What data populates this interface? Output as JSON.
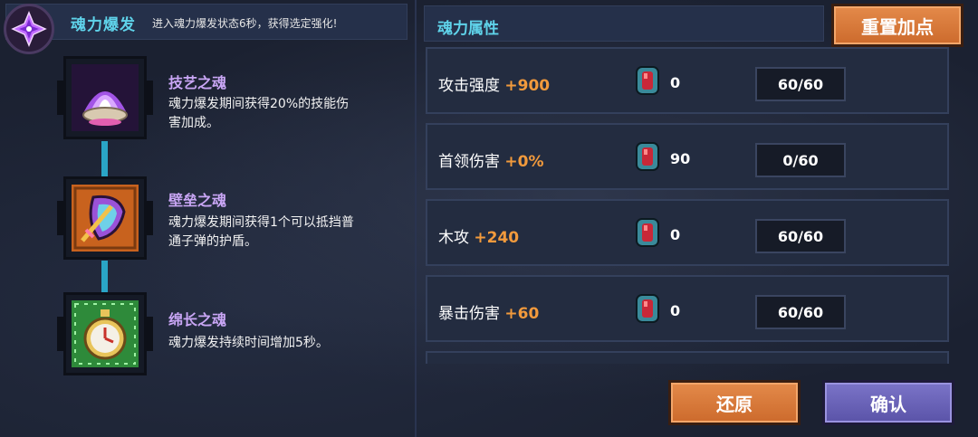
{
  "burst": {
    "title": "魂力爆发",
    "description": "进入魂力爆发状态6秒，获得选定强化!",
    "icon": "purple-crystal-burst-icon"
  },
  "skills": [
    {
      "name": "技艺之魂",
      "line1": "魂力爆发期间获得20%的技能伤",
      "line2": "害加成。",
      "icon": "purple-flame-shell-icon",
      "color": "#a254e6"
    },
    {
      "name": "壁垒之魂",
      "line1": "魂力爆发期间获得1个可以抵挡普",
      "line2": "通子弹的护盾。",
      "icon": "shield-sword-icon",
      "color": "#e0782c"
    },
    {
      "name": "绵长之魂",
      "line1": "魂力爆发持续时间增加5秒。",
      "line2": "",
      "icon": "stopwatch-icon",
      "color": "#3fb04a"
    }
  ],
  "attributes": {
    "title": "魂力属性",
    "reset_label": "重置加点",
    "rows": [
      {
        "name": "攻击强度",
        "bonus": "+900",
        "gems": "0",
        "level": "60/60"
      },
      {
        "name": "首领伤害",
        "bonus": "+0%",
        "gems": "90",
        "level": "0/60"
      },
      {
        "name": "木攻",
        "bonus": "+240",
        "gems": "0",
        "level": "60/60"
      },
      {
        "name": "暴击伤害",
        "bonus": "+60",
        "gems": "0",
        "level": "60/60"
      }
    ],
    "gem_icon": "soul-gem-icon"
  },
  "footer": {
    "restore_label": "还原",
    "confirm_label": "确认"
  }
}
